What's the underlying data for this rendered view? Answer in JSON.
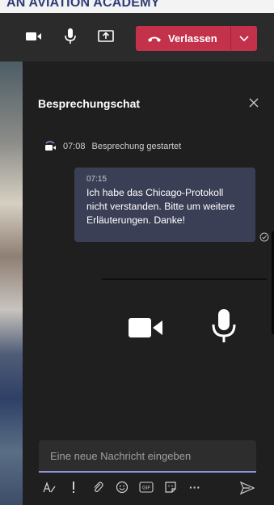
{
  "banner": {
    "text": "AN AVIATION ACADEMY"
  },
  "toolbar": {
    "video": "video-camera-icon",
    "mic": "microphone-icon",
    "share": "share-screen-icon",
    "leave_label": "Verlassen",
    "leave_icon": "hangup-phone-icon",
    "caret": "chevron-down-icon"
  },
  "panel": {
    "title": "Besprechungschat",
    "close": "close-icon"
  },
  "system_message": {
    "time": "07:08",
    "text": "Besprechung gestartet",
    "icon": "meeting-icon"
  },
  "message": {
    "time": "07:15",
    "text": "Ich habe das Chicago-Protokoll nicht verstanden. Bitte um weitere Erläuterungen. Danke!",
    "status": "sent-check-icon"
  },
  "composer": {
    "placeholder": "Eine neue Nachricht eingeben"
  },
  "format_bar": {
    "icons": [
      "format-icon",
      "important-icon",
      "attach-icon",
      "emoji-icon",
      "gif-icon",
      "sticker-icon",
      "more-icon"
    ],
    "gif_label": "GIF",
    "more_label": "···",
    "send": "send-icon"
  },
  "colors": {
    "accent": "#8e92d9",
    "leave": "#c4314b",
    "bubble": "#3b3f55",
    "panel": "#1f1f1f",
    "toolbar": "#2b2b2b"
  }
}
